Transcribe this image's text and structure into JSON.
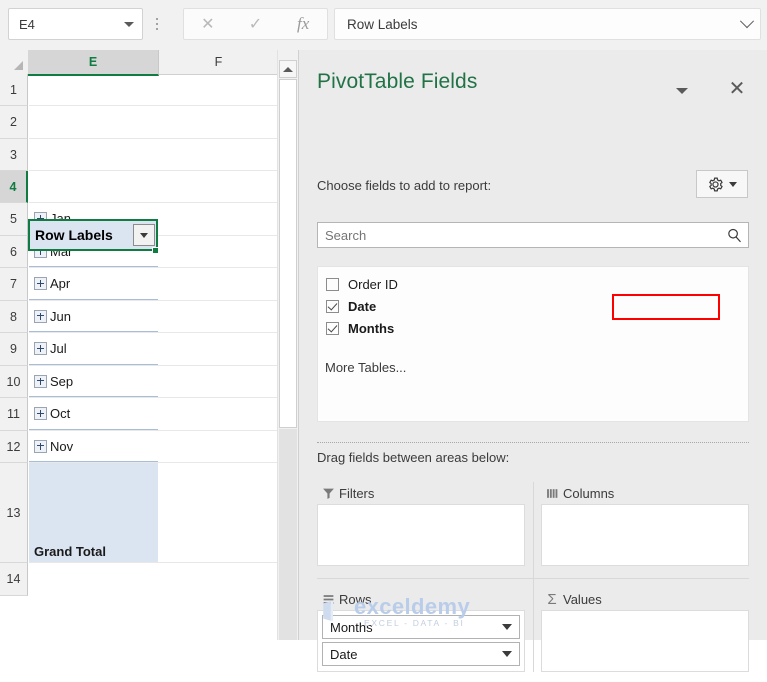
{
  "formula_bar": {
    "name_box_value": "E4",
    "cancel_icon": "close-icon",
    "confirm_icon": "checkmark-icon",
    "function_icon": "fx-icon",
    "formula_value": "Row Labels"
  },
  "grid": {
    "columns": [
      "E",
      "F"
    ],
    "selected_column": "E",
    "selected_row": "4",
    "row_numbers": [
      "1",
      "2",
      "3",
      "4",
      "5",
      "6",
      "7",
      "8",
      "9",
      "10",
      "11",
      "12",
      "13",
      "14"
    ],
    "selected_cell": {
      "ref": "E4",
      "value": "Row Labels",
      "has_filter_button": true
    },
    "pivot_rows": [
      {
        "row": "5",
        "label": "Jan",
        "expandable": true
      },
      {
        "row": "6",
        "label": "Mar",
        "expandable": true
      },
      {
        "row": "7",
        "label": "Apr",
        "expandable": true
      },
      {
        "row": "8",
        "label": "Jun",
        "expandable": true
      },
      {
        "row": "9",
        "label": "Jul",
        "expandable": true
      },
      {
        "row": "10",
        "label": "Sep",
        "expandable": true
      },
      {
        "row": "11",
        "label": "Oct",
        "expandable": true
      },
      {
        "row": "12",
        "label": "Nov",
        "expandable": true
      }
    ],
    "grand_total": {
      "row": "13",
      "label": "Grand Total"
    }
  },
  "panel": {
    "title": "PivotTable Fields",
    "title_color": "#217346",
    "collapse_icon": "chevron-down-icon",
    "close_icon": "close-icon",
    "choose_label": "Choose fields to add to report:",
    "tools_icon": "gear-icon",
    "search": {
      "placeholder": "Search",
      "value": "",
      "icon": "search-icon"
    },
    "fields": [
      {
        "label": "Order ID",
        "checked": false,
        "highlighted": false
      },
      {
        "label": "Date",
        "checked": true,
        "highlighted": true
      },
      {
        "label": "Months",
        "checked": true,
        "highlighted": false
      }
    ],
    "more_tables_label": "More Tables...",
    "drag_label": "Drag fields between areas below:",
    "areas": [
      {
        "name": "Filters",
        "icon": "filter-icon",
        "fields": []
      },
      {
        "name": "Columns",
        "icon": "columns-icon",
        "fields": []
      },
      {
        "name": "Rows",
        "icon": "rows-icon",
        "fields": [
          "Months",
          "Date"
        ]
      },
      {
        "name": "Values",
        "icon": "sigma-icon",
        "fields": []
      }
    ],
    "annotation_color": "#ff0000"
  },
  "watermark": {
    "text": "exceldemy",
    "subtitle": "EXCEL - DATA - BI"
  }
}
